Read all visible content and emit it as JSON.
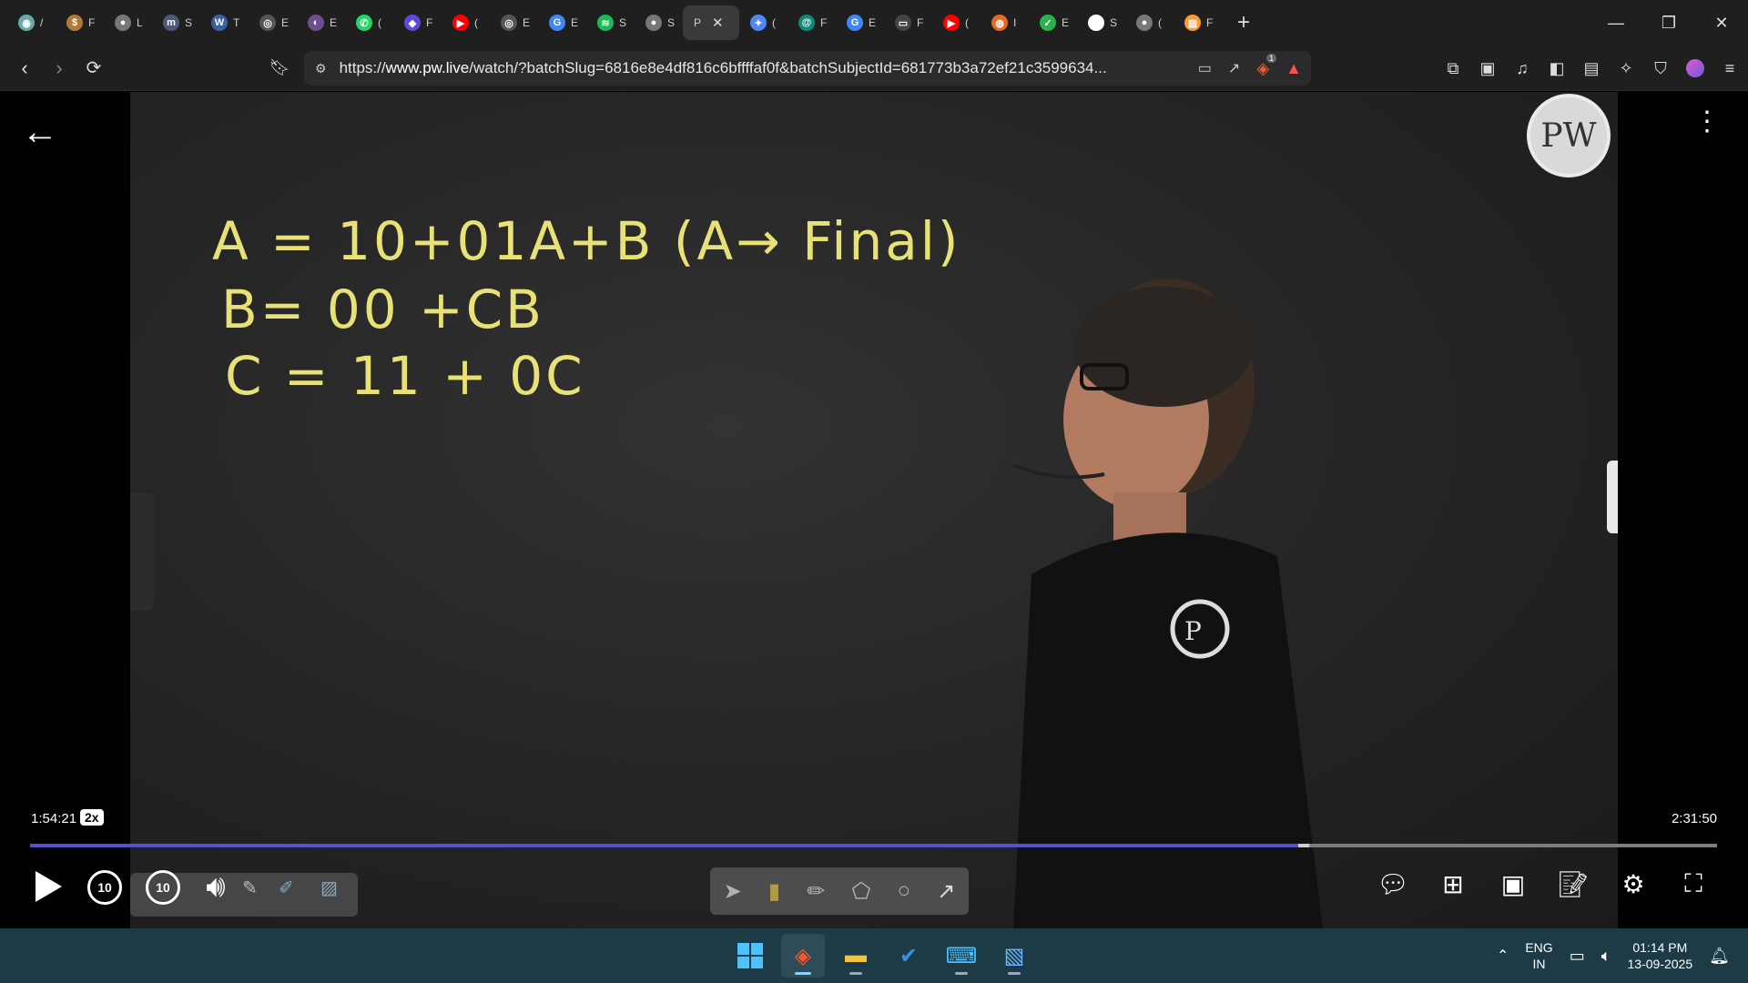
{
  "browser": {
    "tabs": [
      {
        "letter": "/",
        "color": "#6aa9a6",
        "glyph": "◉"
      },
      {
        "letter": "F",
        "color": "#b07a35",
        "glyph": "$"
      },
      {
        "letter": "L",
        "color": "#777777",
        "glyph": "●"
      },
      {
        "letter": "S",
        "color": "#4c5a78",
        "glyph": "m"
      },
      {
        "letter": "T",
        "color": "#3a5fa3",
        "glyph": "W"
      },
      {
        "letter": "E",
        "color": "#555555",
        "glyph": "◎"
      },
      {
        "letter": "E",
        "color": "#6d4f8f",
        "glyph": "◐"
      },
      {
        "letter": "(",
        "color": "#25d366",
        "glyph": "✆"
      },
      {
        "letter": "F",
        "color": "#5d4ad6",
        "glyph": "◆"
      },
      {
        "letter": "(",
        "color": "#ff0000",
        "glyph": "▶"
      },
      {
        "letter": "E",
        "color": "#555555",
        "glyph": "◎"
      },
      {
        "letter": "E",
        "color": "#4285f4",
        "glyph": "G"
      },
      {
        "letter": "S",
        "color": "#1db954",
        "glyph": "≋"
      },
      {
        "letter": "S",
        "color": "#777777",
        "glyph": "●"
      },
      {
        "letter": "P",
        "color": "#3a3a3a",
        "glyph": "",
        "active": true
      },
      {
        "letter": "(",
        "color": "#4f86f7",
        "glyph": "✦"
      },
      {
        "letter": "F",
        "color": "#0e8a7a",
        "glyph": "@"
      },
      {
        "letter": "E",
        "color": "#4285f4",
        "glyph": "G"
      },
      {
        "letter": "F",
        "color": "#444444",
        "glyph": "▭"
      },
      {
        "letter": "(",
        "color": "#ff0000",
        "glyph": "▶"
      },
      {
        "letter": "I",
        "color": "#e56a1f",
        "glyph": "◍"
      },
      {
        "letter": "E",
        "color": "#2bb24c",
        "glyph": "✓"
      },
      {
        "letter": "S",
        "color": "#ffffff",
        "glyph": "W"
      },
      {
        "letter": "(",
        "color": "#777777",
        "glyph": "●"
      },
      {
        "letter": "F",
        "color": "#ff9933",
        "glyph": "▤"
      }
    ],
    "active_tab_close": "✕",
    "url_prefix": "https://",
    "url_host": "www.pw.live",
    "url_rest": "/watch/?batchSlug=6816e8e4df816c6bffffaf0f&batchSubjectId=681773b3a72ef21c3599634...",
    "brave_badge": "1"
  },
  "video": {
    "board_lines": [
      "A = 10+01A+B  (A→ Final)",
      "B= 00 +CB",
      "C = 11 + 0C"
    ],
    "logo": "PW",
    "current_time": "1:54:21",
    "speed": "2x",
    "duration": "2:31:50",
    "progress": 0.752,
    "buffered": 0.758,
    "skip_back": "10",
    "skip_forward": "10"
  },
  "taskbar": {
    "lang_top": "ENG",
    "lang_bottom": "IN",
    "time": "01:14 PM",
    "date": "13-09-2025"
  }
}
